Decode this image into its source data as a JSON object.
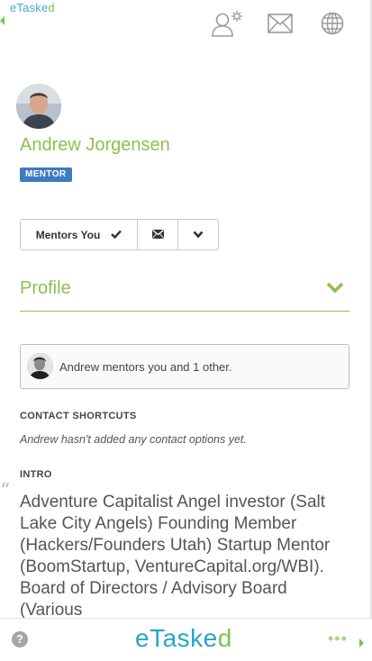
{
  "app": {
    "top_logo_main": "eTaske",
    "top_logo_dot": "d"
  },
  "top_icons": [
    "account-settings-icon",
    "mail-icon",
    "globe-icon"
  ],
  "profile": {
    "name": "Andrew Jorgensen",
    "badge": "MENTOR"
  },
  "buttons": {
    "mentors_you_label": "Mentors You",
    "icons": [
      "check-icon",
      "envelope-icon",
      "chevron-down-icon"
    ]
  },
  "profile_section": {
    "title": "Profile"
  },
  "mentors": {
    "text": "Andrew mentors you and 1 other."
  },
  "contact_shortcuts": {
    "label": "CONTACT SHORTCUTS",
    "note": "Andrew hasn't added any contact options yet."
  },
  "intro": {
    "label": "INTRO",
    "quote_mark": "“",
    "text": "Adventure Capitalist  Angel investor (Salt Lake City Angels) Founding Member (Hackers/Founders Utah) Startup Mentor (BoomStartup, VentureCapital.org/WBI).  Board of Directors / Advisory Board (Various"
  },
  "bottom_bar": {
    "help": "?",
    "logo_main": "eTaske",
    "logo_dot": "d",
    "more": "•••"
  },
  "colors": {
    "accent_green": "#8cc152",
    "badge_blue": "#3d7bc0",
    "logo_blue": "#26a7c6"
  }
}
